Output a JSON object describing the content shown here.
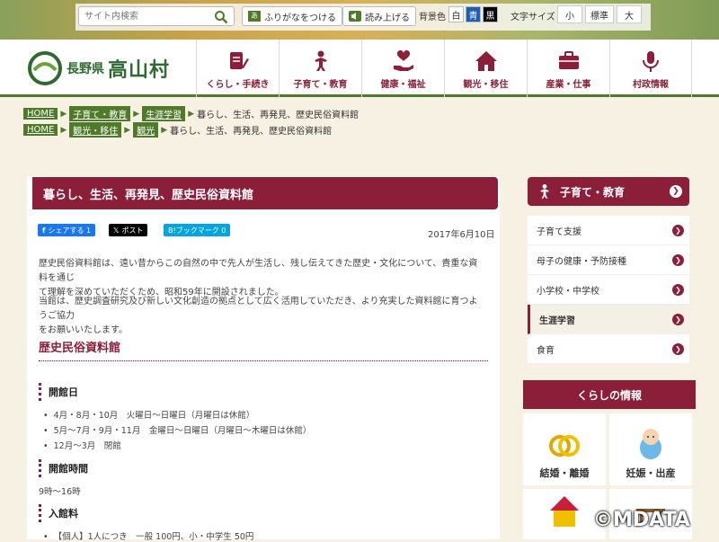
{
  "topbar": {
    "search_placeholder": "サイト内検索",
    "furigana": "ふりがなをつける",
    "read_aloud": "読み上げる",
    "bg_label": "背景色",
    "bg_white": "白",
    "bg_blue": "青",
    "bg_black": "黒",
    "fontsize_label": "文字サイズ",
    "fs_small": "小",
    "fs_standard": "標準",
    "fs_large": "大"
  },
  "logo": {
    "pref": "長野県",
    "village": "高山村"
  },
  "nav": [
    {
      "label": "くらし・手続き"
    },
    {
      "label": "子育て・教育"
    },
    {
      "label": "健康・福祉"
    },
    {
      "label": "観光・移住"
    },
    {
      "label": "産業・仕事"
    },
    {
      "label": "村政情報"
    }
  ],
  "breadcrumbs": [
    {
      "items": [
        "HOME",
        "子育て・教育",
        "生涯学習"
      ],
      "current": "暮らし、生活、再発見、歴史民俗資料館"
    },
    {
      "items": [
        "HOME",
        "観光・移住",
        "観光"
      ],
      "current": "暮らし、生活、再発見、歴史民俗資料館"
    }
  ],
  "page": {
    "title": "暮らし、生活、再発見、歴史民俗資料館",
    "share_fb": "シェアする 1",
    "share_x": "ポスト",
    "share_hatena": "B!ブックマーク 0",
    "date": "2017年6月10日",
    "para1_l1": "歴史民俗資料館は、遠い昔からこの自然の中で先人が生活し、残し伝えてきた歴史・文化について、貴重な資料を通じ",
    "para1_l2": "て理解を深めていただくため、昭和59年に開設されました。",
    "para2_l1": "当館は、歴史調査研究及び新しい文化創造の拠点として広く活用していただき、より充実した資料館に育つようご協力",
    "para2_l2": "をお願いいたします。",
    "section_title": "歴史民俗資料館",
    "open_days_h": "開館日",
    "open_days": [
      "4月・8月・10月　火曜日～日曜日（月曜日は休館）",
      "5月～7月・9月・11月　金曜日～日曜日（月曜日～木曜日は休館）",
      "12月～3月　閉館"
    ],
    "hours_h": "開館時間",
    "hours": "9時～16時",
    "fee_h": "入館料",
    "fee_item": "【個人】1人につき　一般 100円、小・中学生 50円"
  },
  "sidebar": {
    "head": "子育て・教育",
    "items": [
      {
        "label": "子育て支援"
      },
      {
        "label": "母子の健康・予防接種"
      },
      {
        "label": "小学校・中学校"
      },
      {
        "label": "生涯学習"
      },
      {
        "label": "食育"
      }
    ],
    "info_head": "くらしの情報",
    "tiles": [
      {
        "label": "結婚・離婚"
      },
      {
        "label": "妊娠・出産"
      }
    ]
  },
  "watermark": "©MDATA",
  "colors": {
    "accent": "#8b1f3a",
    "green": "#4e7a2a",
    "bg": "#f7f1e3"
  }
}
